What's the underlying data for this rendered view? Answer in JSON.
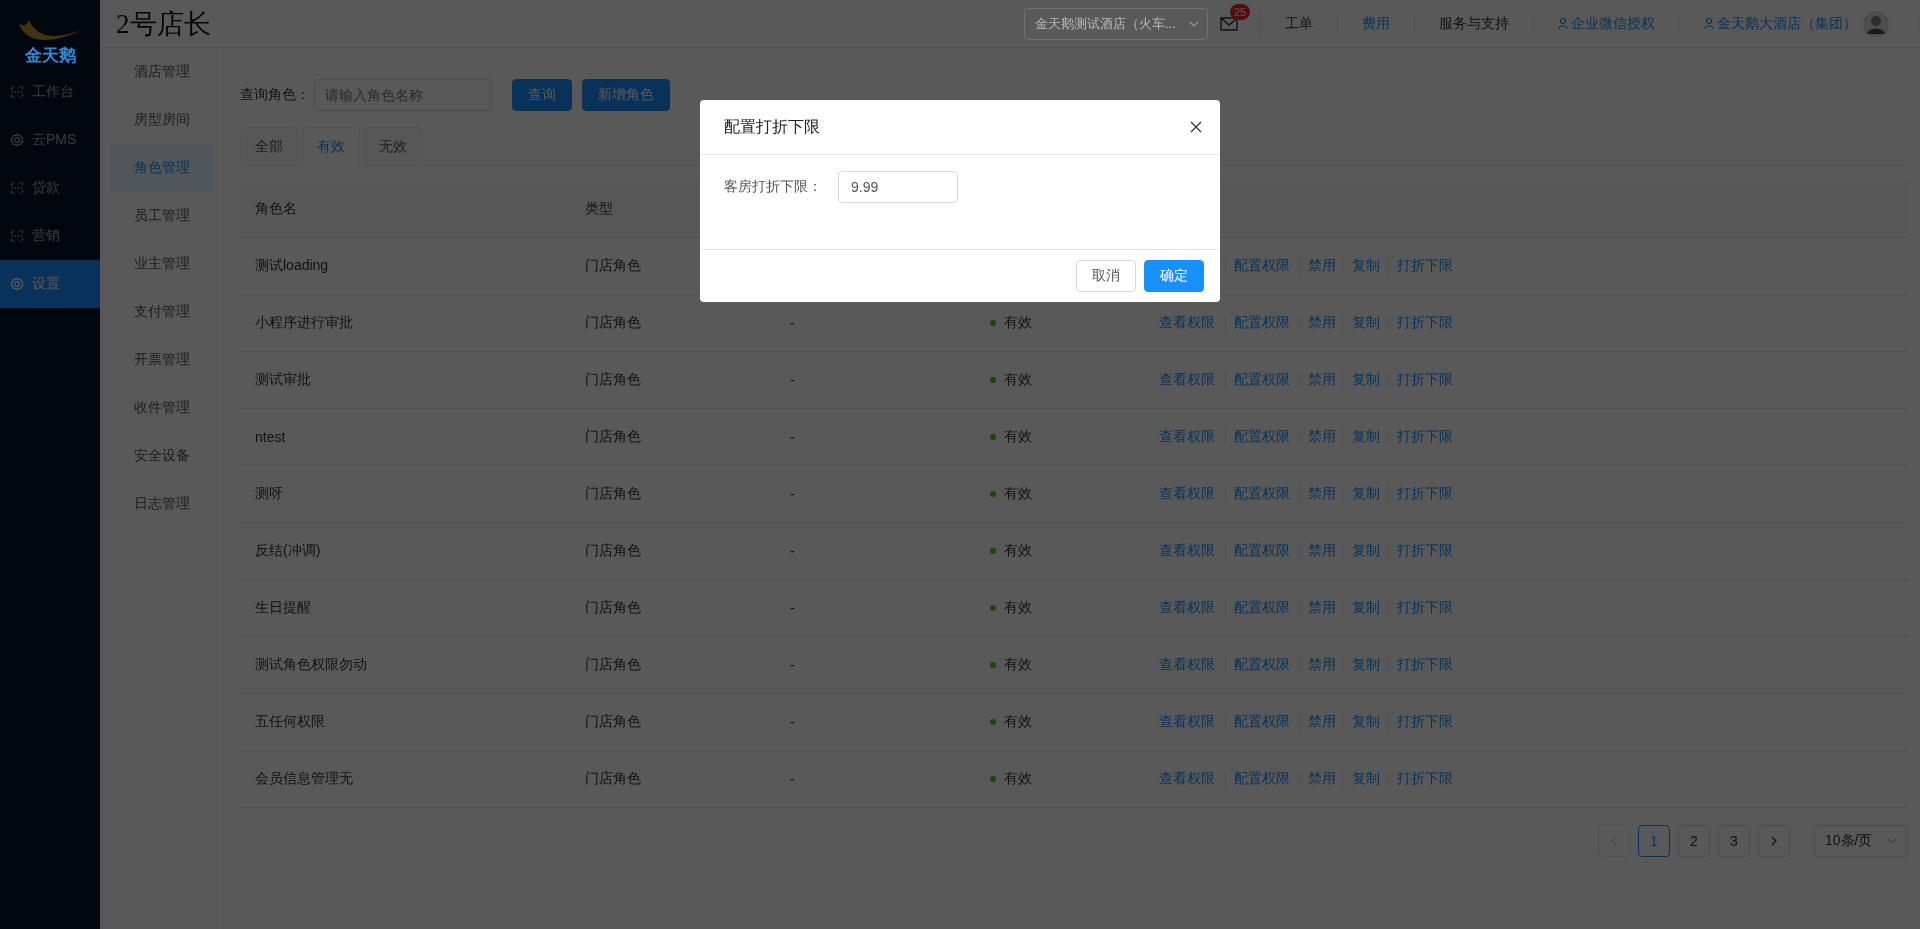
{
  "logo": {
    "text": "金天鹅"
  },
  "app_title": "2号店长",
  "header": {
    "store_select": "金天鹅测试酒店（火车...",
    "mail_badge": "25",
    "links": [
      {
        "label": "工单",
        "kind": "plain"
      },
      {
        "label": "费用",
        "kind": "accent"
      },
      {
        "label": "服务与支持",
        "kind": "plain"
      },
      {
        "label": "企业微信授权",
        "kind": "account"
      },
      {
        "label": "金天鹅大酒店（集团）",
        "kind": "account"
      }
    ]
  },
  "nav": [
    {
      "label": "工作台",
      "kind": "frame",
      "selected": false
    },
    {
      "label": "云PMS",
      "kind": "gear",
      "selected": false
    },
    {
      "label": "贷款",
      "kind": "frame",
      "selected": false
    },
    {
      "label": "营销",
      "kind": "frame",
      "selected": false
    },
    {
      "label": "设置",
      "kind": "gear",
      "selected": true
    }
  ],
  "subnav": [
    {
      "label": "酒店管理",
      "selected": false
    },
    {
      "label": "房型房间",
      "selected": false
    },
    {
      "label": "角色管理",
      "selected": true
    },
    {
      "label": "员工管理",
      "selected": false
    },
    {
      "label": "业主管理",
      "selected": false
    },
    {
      "label": "支付管理",
      "selected": false
    },
    {
      "label": "开票管理",
      "selected": false
    },
    {
      "label": "收件管理",
      "selected": false
    },
    {
      "label": "安全设备",
      "selected": false
    },
    {
      "label": "日志管理",
      "selected": false
    }
  ],
  "query": {
    "label": "查询角色：",
    "placeholder": "请输入角色名称",
    "buttons": [
      "查询",
      "新增角色"
    ]
  },
  "tabs": [
    {
      "label": "全部",
      "selected": false
    },
    {
      "label": "有效",
      "selected": true
    },
    {
      "label": "无效",
      "selected": false
    }
  ],
  "table": {
    "columns": [
      "角色名",
      "类型"
    ],
    "rows": [
      {
        "name": "测试loading",
        "type": "门店角色",
        "actions": [
          {
            "label": "配置权限",
            "kind": "configure"
          },
          {
            "label": "禁用",
            "kind": "disable"
          },
          {
            "label": "复制",
            "kind": "copy"
          },
          {
            "label": "打折下限",
            "kind": "discount"
          }
        ]
      },
      {
        "name": "小程序进行审批",
        "type": "门店角色",
        "column_3": "-",
        "status": {
          "label": "有效",
          "color": "#1d4509"
        },
        "actions": [
          {
            "label": "查看权限",
            "kind": "view"
          },
          {
            "label": "配置权限",
            "kind": "configure"
          },
          {
            "label": "禁用",
            "kind": "disable"
          },
          {
            "label": "复制",
            "kind": "copy"
          },
          {
            "label": "打折下限",
            "kind": "discount"
          }
        ]
      },
      {
        "name": "测试审批",
        "type": "门店角色",
        "column_3": "-",
        "status": {
          "label": "有效",
          "color": "#1d4509"
        },
        "actions": [
          {
            "label": "查看权限",
            "kind": "view"
          },
          {
            "label": "配置权限",
            "kind": "configure"
          },
          {
            "label": "禁用",
            "kind": "disable"
          },
          {
            "label": "复制",
            "kind": "copy"
          },
          {
            "label": "打折下限",
            "kind": "discount"
          }
        ]
      },
      {
        "name": "ntest",
        "type": "门店角色",
        "column_3": "-",
        "status": {
          "label": "有效",
          "color": "#1d4509"
        },
        "actions": [
          {
            "label": "查看权限",
            "kind": "view"
          },
          {
            "label": "配置权限",
            "kind": "configure"
          },
          {
            "label": "禁用",
            "kind": "disable"
          },
          {
            "label": "复制",
            "kind": "copy"
          },
          {
            "label": "打折下限",
            "kind": "discount"
          }
        ]
      },
      {
        "name": "测呀",
        "type": "门店角色",
        "column_3": "-",
        "status": {
          "label": "有效",
          "color": "#1d4509"
        },
        "actions": [
          {
            "label": "查看权限",
            "kind": "view"
          },
          {
            "label": "配置权限",
            "kind": "configure"
          },
          {
            "label": "禁用",
            "kind": "disable"
          },
          {
            "label": "复制",
            "kind": "copy"
          },
          {
            "label": "打折下限",
            "kind": "discount"
          }
        ]
      },
      {
        "name": "反结(冲调)",
        "type": "门店角色",
        "column_3": "-",
        "status": {
          "label": "有效",
          "color": "#1d4509"
        },
        "actions": [
          {
            "label": "查看权限",
            "kind": "view"
          },
          {
            "label": "配置权限",
            "kind": "configure"
          },
          {
            "label": "禁用",
            "kind": "disable"
          },
          {
            "label": "复制",
            "kind": "copy"
          },
          {
            "label": "打折下限",
            "kind": "discount"
          }
        ]
      },
      {
        "name": "生日提醒",
        "type": "门店角色",
        "column_3": "-",
        "status": {
          "label": "有效",
          "color": "#1d4509"
        },
        "actions": [
          {
            "label": "查看权限",
            "kind": "view"
          },
          {
            "label": "配置权限",
            "kind": "configure"
          },
          {
            "label": "禁用",
            "kind": "disable"
          },
          {
            "label": "复制",
            "kind": "copy"
          },
          {
            "label": "打折下限",
            "kind": "discount"
          }
        ]
      },
      {
        "name": "测试角色权限勿动",
        "type": "门店角色",
        "column_3": "-",
        "status": {
          "label": "有效",
          "color": "#1d4509"
        },
        "actions": [
          {
            "label": "查看权限",
            "kind": "view"
          },
          {
            "label": "配置权限",
            "kind": "configure"
          },
          {
            "label": "禁用",
            "kind": "disable"
          },
          {
            "label": "复制",
            "kind": "copy"
          },
          {
            "label": "打折下限",
            "kind": "discount"
          }
        ]
      },
      {
        "name": "五任何权限",
        "type": "门店角色",
        "column_3": "-",
        "status": {
          "label": "有效",
          "color": "#1d4509"
        },
        "actions": [
          {
            "label": "查看权限",
            "kind": "view"
          },
          {
            "label": "配置权限",
            "kind": "configure"
          },
          {
            "label": "禁用",
            "kind": "disable"
          },
          {
            "label": "复制",
            "kind": "copy"
          },
          {
            "label": "打折下限",
            "kind": "discount"
          }
        ]
      },
      {
        "name": "会员信息管理无",
        "type": "门店角色",
        "column_3": "-",
        "status": {
          "label": "有效",
          "color": "#1d4509"
        },
        "actions": [
          {
            "label": "查看权限",
            "kind": "view"
          },
          {
            "label": "配置权限",
            "kind": "configure"
          },
          {
            "label": "禁用",
            "kind": "disable"
          },
          {
            "label": "复制",
            "kind": "copy"
          },
          {
            "label": "打折下限",
            "kind": "discount"
          }
        ]
      }
    ]
  },
  "pagination": {
    "prev": {
      "disabled": true
    },
    "next": {
      "disabled": false
    },
    "pages": [
      {
        "label": "1",
        "selected": true
      },
      {
        "label": "2",
        "selected": false
      },
      {
        "label": "3",
        "selected": false
      }
    ],
    "page_size": "10条/页"
  },
  "dialog": {
    "title": "配置打折下限",
    "field_label": "客房打折下限：",
    "value": "9.99",
    "buttons": [
      {
        "label": "取消",
        "kind": "default"
      },
      {
        "label": "确定",
        "kind": "primary"
      }
    ]
  }
}
